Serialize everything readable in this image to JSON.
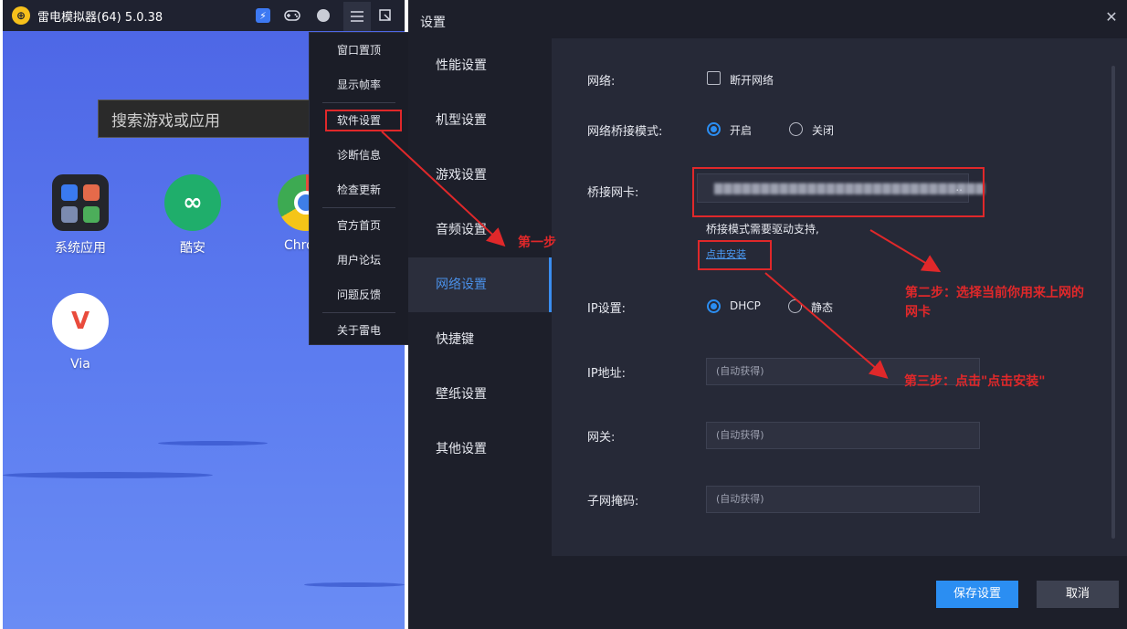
{
  "emulator": {
    "title": "雷电模拟器(64) 5.0.38",
    "logo_glyph": "⊕",
    "search_placeholder": "搜索游戏或应用",
    "toolbar_icons": [
      "speed-icon",
      "gamepad-icon",
      "user-icon",
      "menu-icon",
      "shrink-icon"
    ],
    "apps": [
      {
        "label": "系统应用"
      },
      {
        "label": "酷安"
      },
      {
        "label": "Chro"
      },
      {
        "label": "Via"
      }
    ]
  },
  "menu": {
    "items": [
      "窗口置顶",
      "显示帧率",
      "软件设置",
      "诊断信息",
      "检查更新",
      "官方首页",
      "用户论坛",
      "问题反馈",
      "关于雷电"
    ]
  },
  "settings": {
    "title": "设置",
    "close_glyph": "✕",
    "nav": [
      "性能设置",
      "机型设置",
      "游戏设置",
      "音频设置",
      "网络设置",
      "快捷键",
      "壁纸设置",
      "其他设置"
    ],
    "active_nav": "网络设置",
    "network": {
      "label": "网络:",
      "disconnect_label": "断开网络",
      "disconnect_checked": false
    },
    "bridge_mode": {
      "label": "网络桥接模式:",
      "on_label": "开启",
      "off_label": "关闭",
      "selected": "开启"
    },
    "bridge_nic": {
      "label": "桥接网卡:",
      "value": "▇▇▇▇▇▇▇▇▇▇▇▇▇▇▇▇▇▇▇▇▇▇▇▇▇▇▇▇▇",
      "ellipsis": ".."
    },
    "bridge_hint": "桥接模式需要驱动支持,",
    "install_link": "点击安装",
    "ip_setting": {
      "label": "IP设置:",
      "dhcp_label": "DHCP",
      "static_label": "静态",
      "selected": "DHCP"
    },
    "ip_address": {
      "label": "IP地址:",
      "placeholder": "(自动获得)"
    },
    "gateway": {
      "label": "网关:",
      "placeholder": "(自动获得)"
    },
    "subnet": {
      "label": "子网掩码:",
      "placeholder": "(自动获得)"
    },
    "save_label": "保存设置",
    "cancel_label": "取消"
  },
  "annotations": {
    "step1": "第一步",
    "step2_line1": "第二步：选择当前你用来上网的",
    "step2_line2": "网卡",
    "step3": "第三步：点击\"点击安装\"",
    "color": "#e0282a"
  }
}
